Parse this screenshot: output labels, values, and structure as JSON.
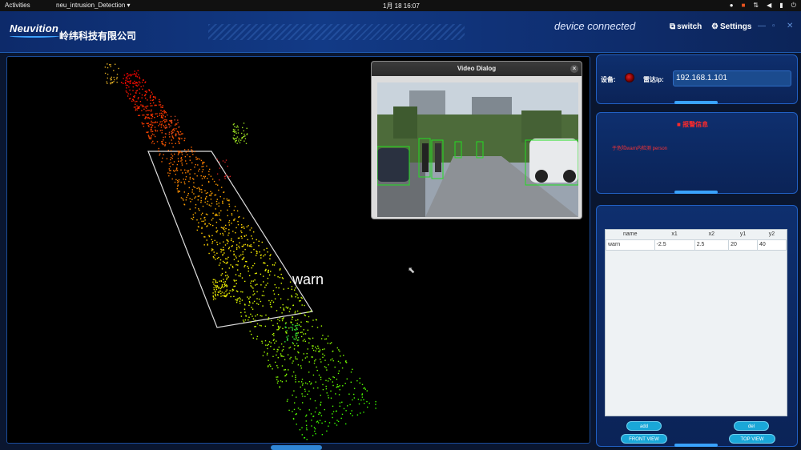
{
  "topbar": {
    "activities": "Activities",
    "app_name": "neu_intrusion_Detection",
    "app_menu_arrow": "▾",
    "datetime": "1月 18  16:07",
    "tray_icons": [
      "chat-icon",
      "network-icon",
      "volume-icon",
      "battery-icon",
      "power-icon"
    ]
  },
  "header": {
    "logo_text": "Neuvition",
    "company_name": "岭纬科技有限公司",
    "device_status": "device connected",
    "switch_label": "switch",
    "settings_label": "Settings",
    "accent_color": "#3aa3ff"
  },
  "viewer": {
    "warn_label": "warn"
  },
  "video_dialog": {
    "title": "Video Dialog"
  },
  "device_panel": {
    "device_label": "设备:",
    "radar_ip_label": "雷达ip:",
    "radar_ip_value": "192.168.1.101",
    "status_color": "#cc1111"
  },
  "alarm_panel": {
    "title": "报警信息",
    "message": "于危险warn内检测 person"
  },
  "zone_table": {
    "headers": [
      "name",
      "x1",
      "x2",
      "y1",
      "y2"
    ],
    "rows": [
      {
        "name": "warn",
        "x1": "-2.5",
        "x2": "2.5",
        "y1": "20",
        "y2": "40"
      }
    ]
  },
  "buttons": {
    "add": "add",
    "del": "del",
    "front_view": "FRONT VIEW",
    "top_view": "TOP VIEW"
  }
}
